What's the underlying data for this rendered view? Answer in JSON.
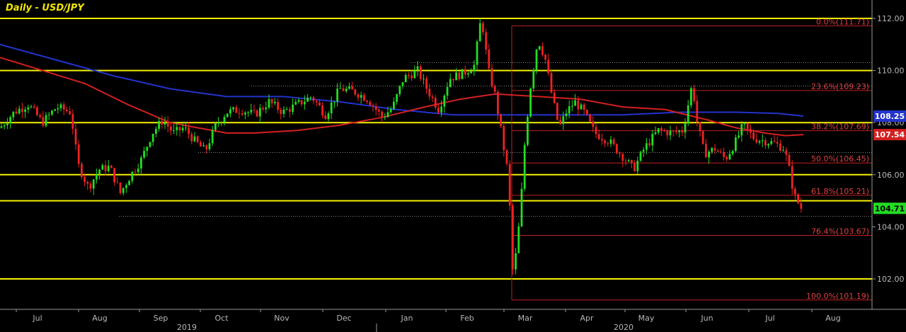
{
  "chart_data": {
    "type": "candlestick",
    "title": "Daily - USD/JPY",
    "ylim": [
      101.0,
      112.5
    ],
    "y_ticks": [
      "112.00",
      "110.00",
      "108.00",
      "106.00",
      "104.00",
      "102.00"
    ],
    "y_tick_values": [
      112.0,
      110.0,
      108.0,
      106.0,
      104.0,
      102.0
    ],
    "x_months": [
      "Jul",
      "Aug",
      "Sep",
      "Oct",
      "Nov",
      "Dec",
      "Jan",
      "Feb",
      "Mar",
      "Apr",
      "May",
      "Jun",
      "Jul",
      "Aug"
    ],
    "x_years": [
      "2019",
      "2020"
    ],
    "horizontal_levels": [
      112.0,
      110.0,
      108.0,
      106.0,
      105.0,
      102.0
    ],
    "fib_levels": [
      {
        "label": "0.0%(111.71)",
        "value": 111.71
      },
      {
        "label": "23.6%(109.23)",
        "value": 109.23
      },
      {
        "label": "38.2%(107.69)",
        "value": 107.69
      },
      {
        "label": "50.0%(106.45)",
        "value": 106.45
      },
      {
        "label": "61.8%(105.21)",
        "value": 105.21
      },
      {
        "label": "76.4%(103.67)",
        "value": 103.67
      },
      {
        "label": "100.0%(101.19)",
        "value": 101.19
      }
    ],
    "last_values": [
      {
        "label": "108.25",
        "value": 108.25,
        "color": "#2233cc"
      },
      {
        "label": "107.54",
        "value": 107.54,
        "color": "#d42020"
      },
      {
        "label": "104.71",
        "value": 104.71,
        "color": "#22dd22"
      }
    ],
    "close_path": [
      [
        0,
        107.8
      ],
      [
        20,
        108.4
      ],
      [
        40,
        108.7
      ],
      [
        60,
        108.0
      ],
      [
        80,
        108.6
      ],
      [
        100,
        108.4
      ],
      [
        110,
        106.4
      ],
      [
        125,
        105.5
      ],
      [
        140,
        106.2
      ],
      [
        155,
        106.3
      ],
      [
        170,
        105.3
      ],
      [
        185,
        106.0
      ],
      [
        200,
        106.6
      ],
      [
        215,
        107.6
      ],
      [
        230,
        108.1
      ],
      [
        245,
        107.6
      ],
      [
        260,
        107.8
      ],
      [
        275,
        107.3
      ],
      [
        290,
        106.9
      ],
      [
        305,
        107.9
      ],
      [
        320,
        108.4
      ],
      [
        340,
        108.5
      ],
      [
        360,
        108.3
      ],
      [
        380,
        108.8
      ],
      [
        400,
        108.4
      ],
      [
        420,
        108.7
      ],
      [
        440,
        109.0
      ],
      [
        460,
        108.3
      ],
      [
        480,
        109.3
      ],
      [
        500,
        109.2
      ],
      [
        520,
        108.9
      ],
      [
        540,
        108.2
      ],
      [
        555,
        108.6
      ],
      [
        570,
        109.7
      ],
      [
        590,
        110.0
      ],
      [
        605,
        109.2
      ],
      [
        620,
        108.5
      ],
      [
        635,
        109.7
      ],
      [
        655,
        109.9
      ],
      [
        670,
        110.2
      ],
      [
        680,
        112.1
      ],
      [
        690,
        110.0
      ],
      [
        700,
        109.0
      ],
      [
        710,
        107.3
      ],
      [
        718,
        106.0
      ],
      [
        725,
        102.0
      ],
      [
        735,
        104.5
      ],
      [
        742,
        107.5
      ],
      [
        750,
        109.5
      ],
      [
        760,
        111.2
      ],
      [
        770,
        110.5
      ],
      [
        780,
        109.0
      ],
      [
        790,
        107.8
      ],
      [
        800,
        108.4
      ],
      [
        812,
        108.8
      ],
      [
        825,
        108.4
      ],
      [
        840,
        107.6
      ],
      [
        860,
        107.3
      ],
      [
        880,
        106.7
      ],
      [
        895,
        106.2
      ],
      [
        910,
        107.0
      ],
      [
        930,
        107.7
      ],
      [
        950,
        107.6
      ],
      [
        965,
        107.7
      ],
      [
        978,
        109.5
      ],
      [
        985,
        108.0
      ],
      [
        995,
        106.8
      ],
      [
        1010,
        107.0
      ],
      [
        1025,
        106.6
      ],
      [
        1040,
        107.3
      ],
      [
        1050,
        107.9
      ],
      [
        1065,
        107.4
      ],
      [
        1080,
        107.3
      ],
      [
        1095,
        107.2
      ],
      [
        1108,
        107.0
      ],
      [
        1115,
        106.2
      ],
      [
        1122,
        105.2
      ],
      [
        1132,
        104.71
      ]
    ],
    "ma_blue": [
      [
        0,
        111.0
      ],
      [
        80,
        110.4
      ],
      [
        160,
        109.8
      ],
      [
        240,
        109.3
      ],
      [
        320,
        109.0
      ],
      [
        400,
        109.0
      ],
      [
        480,
        108.8
      ],
      [
        560,
        108.5
      ],
      [
        640,
        108.3
      ],
      [
        720,
        108.3
      ],
      [
        800,
        108.3
      ],
      [
        880,
        108.3
      ],
      [
        960,
        108.4
      ],
      [
        1040,
        108.4
      ],
      [
        1100,
        108.35
      ],
      [
        1135,
        108.25
      ]
    ],
    "ma_red": [
      [
        0,
        110.5
      ],
      [
        60,
        110.0
      ],
      [
        120,
        109.5
      ],
      [
        180,
        108.7
      ],
      [
        240,
        108.0
      ],
      [
        280,
        107.8
      ],
      [
        320,
        107.6
      ],
      [
        360,
        107.6
      ],
      [
        420,
        107.7
      ],
      [
        480,
        107.9
      ],
      [
        540,
        108.2
      ],
      [
        600,
        108.6
      ],
      [
        650,
        108.9
      ],
      [
        700,
        109.1
      ],
      [
        760,
        109.0
      ],
      [
        820,
        108.9
      ],
      [
        880,
        108.6
      ],
      [
        940,
        108.5
      ],
      [
        1000,
        108.1
      ],
      [
        1040,
        107.8
      ],
      [
        1080,
        107.6
      ],
      [
        1110,
        107.5
      ],
      [
        1135,
        107.54
      ]
    ]
  }
}
